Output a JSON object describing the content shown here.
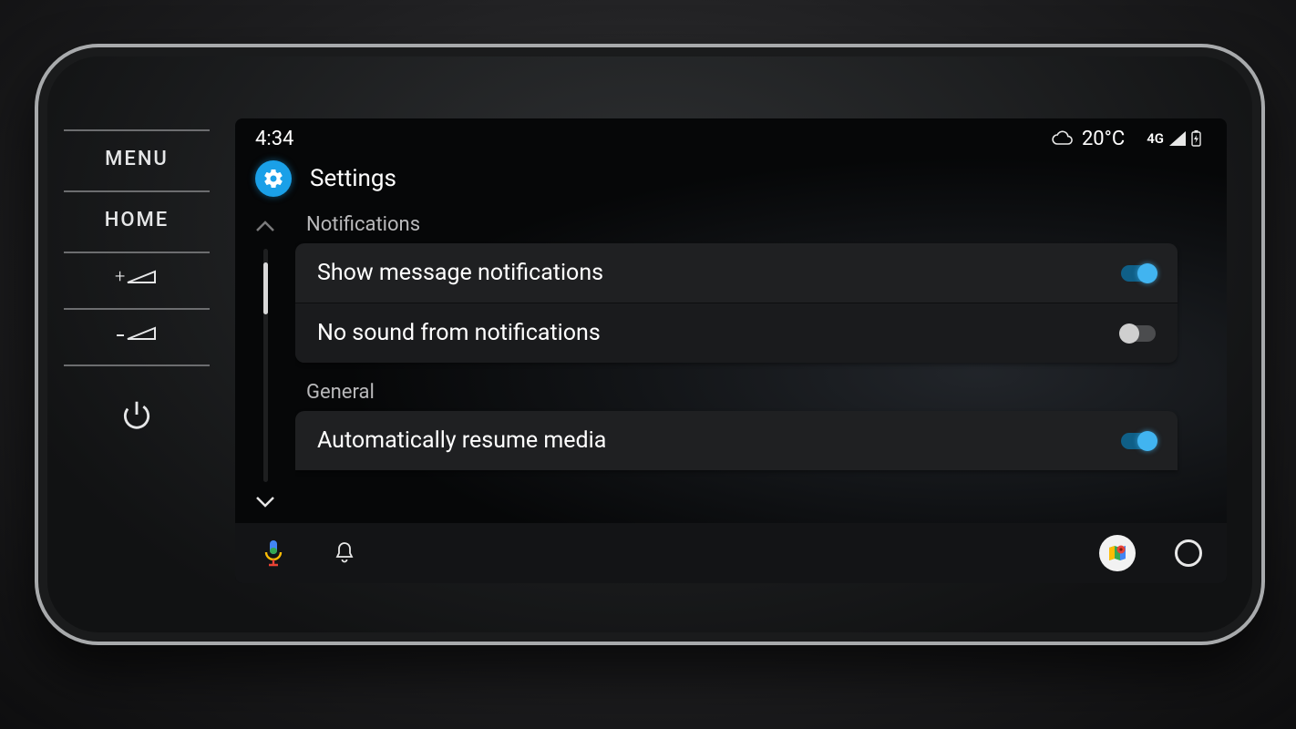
{
  "hardware_buttons": {
    "menu": "MENU",
    "home": "HOME"
  },
  "statusbar": {
    "time": "4:34",
    "temperature": "20°C",
    "network": "4G"
  },
  "header": {
    "title": "Settings"
  },
  "sections": {
    "notifications": {
      "label": "Notifications",
      "items": [
        {
          "label": "Show message notifications",
          "enabled": true
        },
        {
          "label": "No sound from notifications",
          "enabled": false
        }
      ]
    },
    "general": {
      "label": "General",
      "items": [
        {
          "label": "Automatically resume media",
          "enabled": true
        }
      ]
    }
  },
  "colors": {
    "accent": "#41b4f0",
    "card": "#1f2022"
  }
}
